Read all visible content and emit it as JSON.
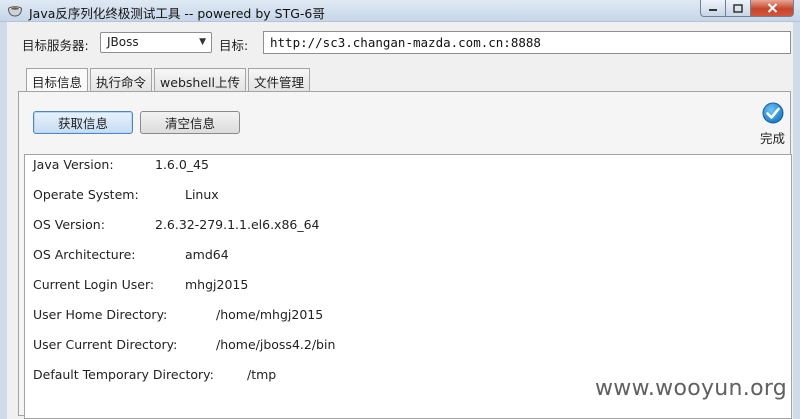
{
  "window": {
    "title": "Java反序列化终极测试工具  -- powered by STG-6哥",
    "app_icon": "coffee-cup-icon",
    "controls": {
      "minimize": "minimize-icon",
      "maximize": "maximize-icon",
      "close": "close-icon"
    }
  },
  "toolbar": {
    "server_label": "目标服务器:",
    "server_value": "JBoss",
    "target_label": "目标:",
    "target_value": "http://sc3.changan-mazda.com.cn:8888"
  },
  "tabs": [
    {
      "label": "目标信息",
      "active": true
    },
    {
      "label": "执行命令",
      "active": false
    },
    {
      "label": "webshell上传",
      "active": false
    },
    {
      "label": "文件管理",
      "active": false
    }
  ],
  "actions": {
    "fetch_label": "获取信息",
    "clear_label": "清空信息"
  },
  "status": {
    "icon": "check-circle-icon",
    "text": "完成",
    "color": "#2a8fd8"
  },
  "info_rows": [
    {
      "key": "Java Version:",
      "value": "1.6.0_45"
    },
    {
      "key": "Operate System:",
      "value": "Linux"
    },
    {
      "key": "OS Version:",
      "value": "2.6.32-279.1.1.el6.x86_64"
    },
    {
      "key": "OS Architecture:",
      "value": "amd64"
    },
    {
      "key": "Current Login User:",
      "value": "mhgj2015"
    },
    {
      "key": "User Home Directory:",
      "value": "/home/mhgj2015"
    },
    {
      "key": "User Current Directory:",
      "value": "/home/jboss4.2/bin"
    },
    {
      "key": "Default Temporary Directory:",
      "value": "/tmp"
    }
  ],
  "watermark": "www.wooyun.org"
}
